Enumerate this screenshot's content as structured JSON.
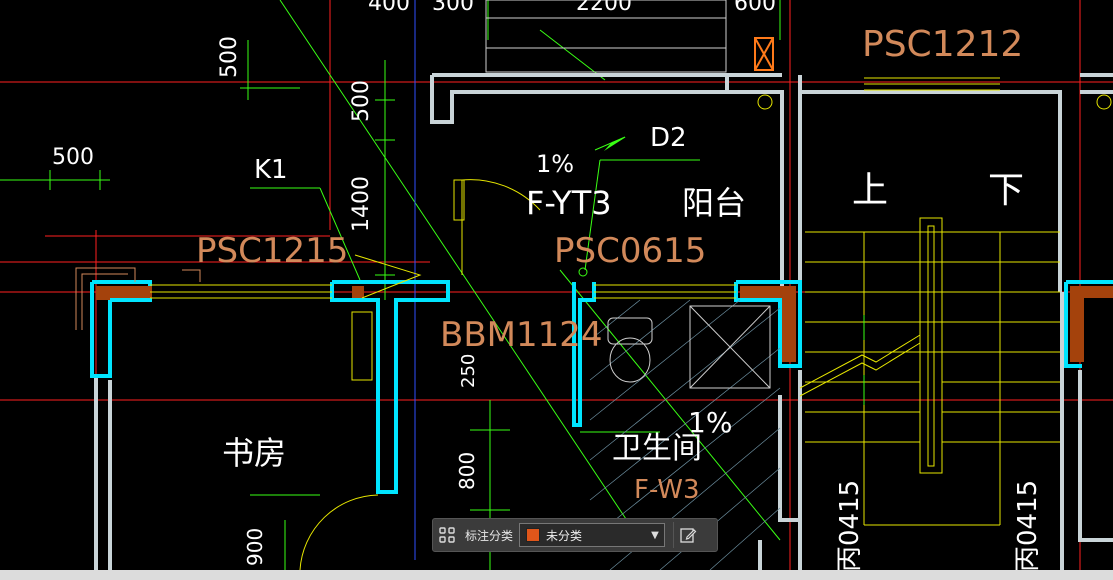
{
  "drawing": {
    "dimensions": {
      "dim_400": "400",
      "dim_300": "300",
      "dim_2200": "2200",
      "dim_600": "600",
      "dim_500_a": "500",
      "dim_500_b": "500",
      "dim_500_c": "500",
      "dim_1400": "1400",
      "dim_250": "250",
      "dim_800": "800",
      "dim_900": "900"
    },
    "labels": {
      "psc1212": "PSC1212",
      "psc1215": "PSC1215",
      "psc0615": "PSC0615",
      "bbm1124": "BBM1124",
      "d2": "D2",
      "k1": "K1",
      "f_yt3": "F-YT3",
      "balcony": "阳台",
      "up": "上",
      "down": "下",
      "study": "书房",
      "bathroom": "卫生间",
      "f_w3": "F-W3",
      "slope_1": "1%",
      "slope_2": "1%",
      "fire_left": "丙0415",
      "fire_right": "丙0415"
    }
  },
  "toolbar": {
    "label": "标注分类",
    "selected": "未分类",
    "swatch_color": "#e0561a"
  },
  "colors": {
    "wall_cyan": "#00e5ff",
    "column_fill": "#a4420c",
    "dim_green": "#39ff14",
    "axis_red": "#ff2020",
    "window_yellow": "#e6e600",
    "tag_orange": "#d2895a",
    "white_text": "#ffffff"
  }
}
